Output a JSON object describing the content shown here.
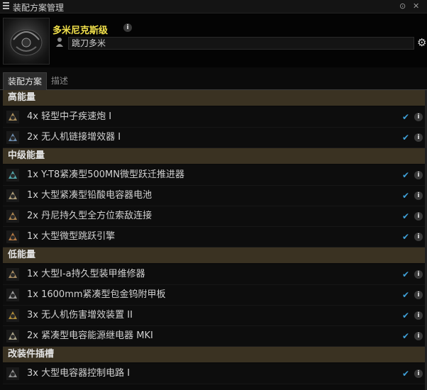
{
  "window": {
    "title": "装配方案管理",
    "buttons": {
      "minimize": "⊙",
      "close": "✕"
    }
  },
  "ship": {
    "name": "多米尼克斯级",
    "fitting_name": "跳刀多米"
  },
  "tabs": [
    "装配方案",
    "描述"
  ],
  "sections": [
    {
      "title": "高能量",
      "items": [
        {
          "qty": "4x",
          "name": "轻型中子疾速炮 I",
          "icon": "blaster-icon"
        },
        {
          "qty": "2x",
          "name": "无人机链接增效器 I",
          "icon": "drone-link-icon"
        }
      ]
    },
    {
      "title": "中级能量",
      "items": [
        {
          "qty": "1x",
          "name": "Y-T8紧凑型500MN微型跃迁推进器",
          "icon": "microwarpdrive-icon"
        },
        {
          "qty": "1x",
          "name": "大型紧凑型铅酸电容器电池",
          "icon": "cap-battery-icon"
        },
        {
          "qty": "2x",
          "name": "丹尼持久型全方位索敌连接",
          "icon": "omnidirectional-link-icon"
        },
        {
          "qty": "1x",
          "name": "大型微型跳跃引擎",
          "icon": "micro-jump-icon"
        }
      ]
    },
    {
      "title": "低能量",
      "items": [
        {
          "qty": "1x",
          "name": "大型I-a持久型装甲维修器",
          "icon": "armor-repairer-icon"
        },
        {
          "qty": "1x",
          "name": "1600mm紧凑型包金钨附甲板",
          "icon": "armor-plate-icon"
        },
        {
          "qty": "3x",
          "name": "无人机伤害增效装置 II",
          "icon": "drone-damage-icon"
        },
        {
          "qty": "2x",
          "name": "紧凑型电容能源继电器 MKI",
          "icon": "cap-relay-icon"
        }
      ]
    },
    {
      "title": "改装件插槽",
      "items": [
        {
          "qty": "3x",
          "name": "大型电容器控制电路 I",
          "icon": "rig-icon"
        }
      ]
    }
  ],
  "colors": {
    "ship_name": "#f2e14b",
    "section_bg": "#3a3222",
    "check": "#3fa0d8"
  }
}
